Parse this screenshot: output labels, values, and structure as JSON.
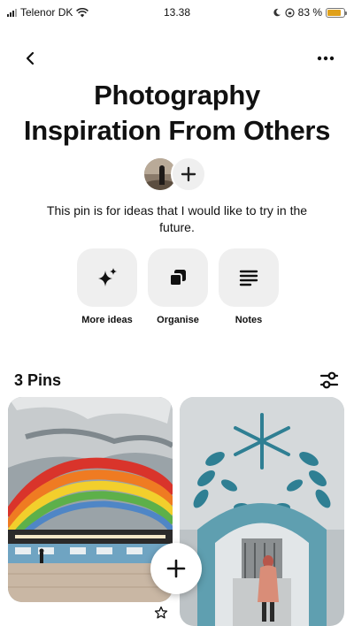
{
  "status_bar": {
    "carrier": "Telenor DK",
    "time": "13.38",
    "battery": "83 %",
    "battery_level": 0.83
  },
  "nav": {
    "back_icon": "chevron-left-icon",
    "more_icon": "more-horizontal-icon"
  },
  "board": {
    "title_line1": "Photography",
    "title_line2": "Inspiration From Others",
    "description_line1": "This pin is for ideas that I would like to try in the",
    "description_line2": "future."
  },
  "actions": [
    {
      "label": "More ideas",
      "icon": "sparkle-icon"
    },
    {
      "label": "Organise",
      "icon": "organise-icon"
    },
    {
      "label": "Notes",
      "icon": "notes-icon"
    }
  ],
  "pins": {
    "count_label": "3 Pins",
    "filter_icon": "filter-icon"
  },
  "colors": {
    "tile_bg": "#efefef",
    "battery": "#e0a11b",
    "text": "#111111"
  }
}
